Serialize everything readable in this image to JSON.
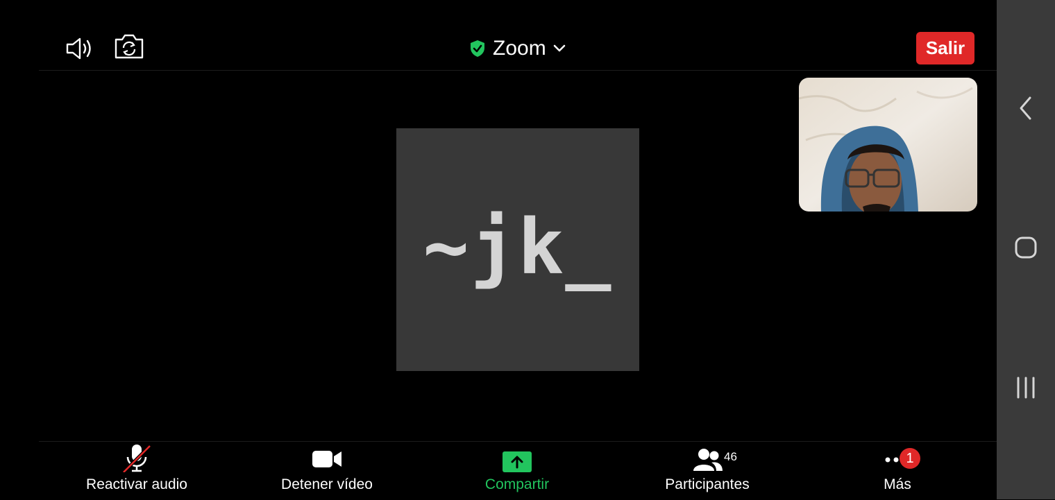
{
  "header": {
    "title": "Zoom",
    "leave_label": "Salir",
    "speaker_icon": "speaker-icon",
    "camera_switch_icon": "camera-switch-icon",
    "shield_icon": "shield-check-icon",
    "chevron_icon": "chevron-down-icon"
  },
  "main": {
    "avatar_text": "~jk_"
  },
  "toolbar": {
    "unmute_label": "Reactivar audio",
    "stop_video_label": "Detener vídeo",
    "share_label": "Compartir",
    "participants_label": "Participantes",
    "participants_count": "46",
    "more_label": "Más",
    "more_badge": "1"
  },
  "colors": {
    "leave": "#e02828",
    "share": "#22c55e",
    "shield": "#22c55e",
    "badge": "#e02828",
    "tile": "#383838",
    "navbar": "#3a3a3a"
  },
  "system_nav": {
    "back_icon": "back-chevron-icon",
    "home_icon": "home-icon",
    "recents_icon": "recents-icon"
  }
}
